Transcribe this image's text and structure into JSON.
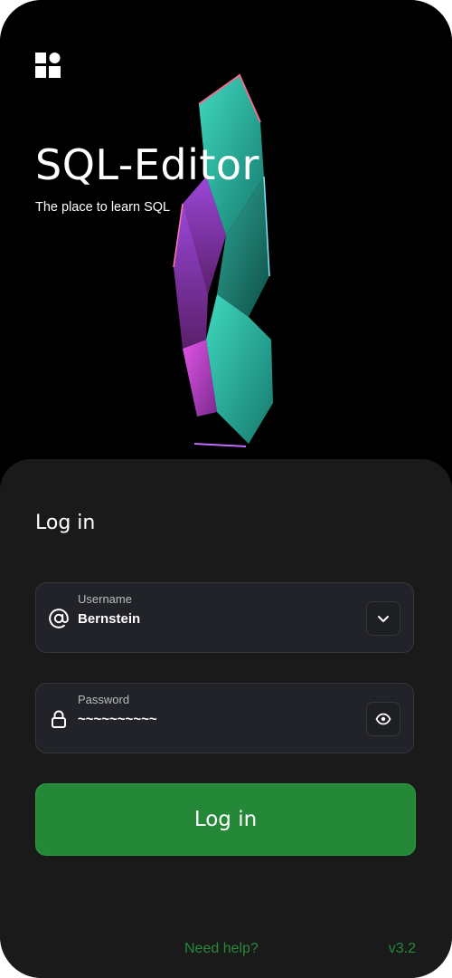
{
  "app": {
    "title": "SQL-Editor",
    "tagline": "The place to learn SQL",
    "logo_icon": "app-logo-grid-icon"
  },
  "login": {
    "heading": "Log in",
    "username": {
      "label": "Username",
      "value": "Bernstein",
      "icon": "at-sign-icon",
      "action_icon": "chevron-down-icon"
    },
    "password": {
      "label": "Password",
      "value": "~~~~~~~~~~",
      "icon": "lock-icon",
      "action_icon": "eye-icon"
    },
    "submit_label": "Log in"
  },
  "footer": {
    "help_label": "Need help?",
    "version": "v3.2"
  },
  "colors": {
    "background": "#000000",
    "sheet": "#1a1a1a",
    "field": "#222328",
    "accent": "#248838",
    "text": "#ffffff"
  }
}
